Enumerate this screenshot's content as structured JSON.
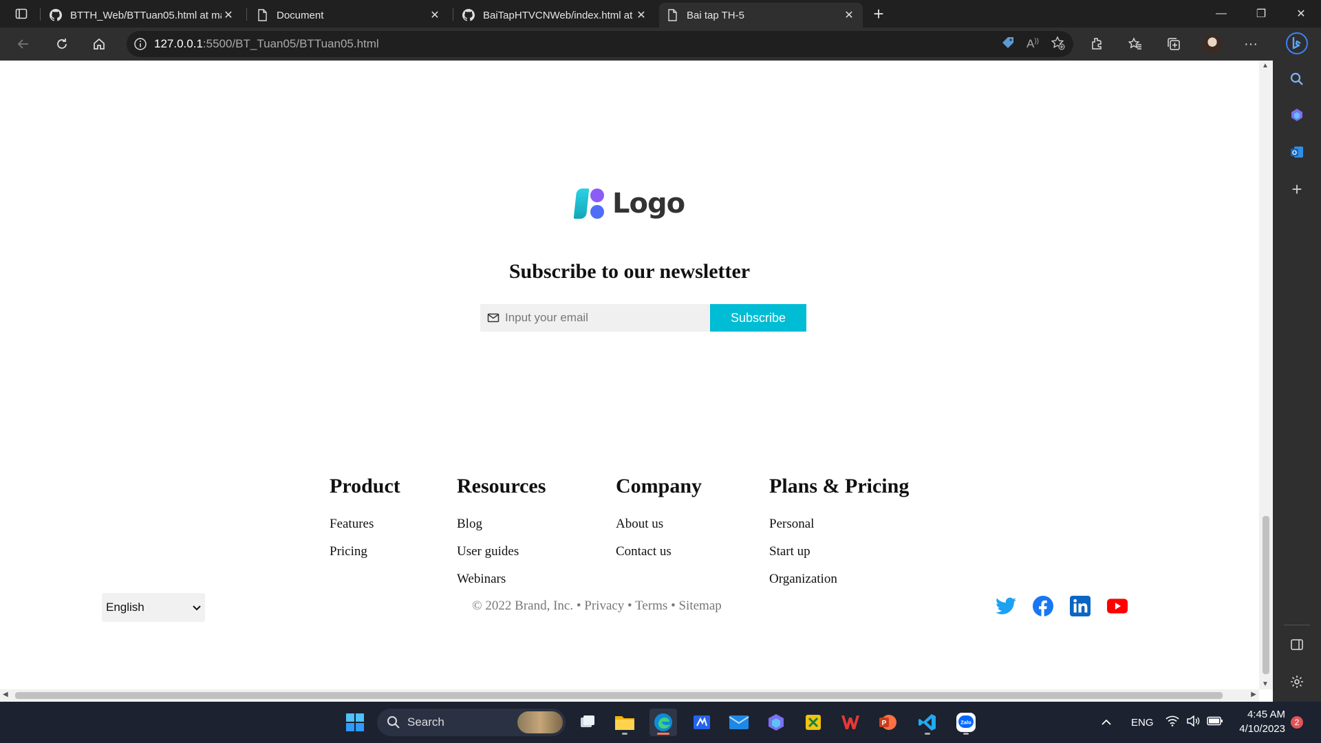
{
  "browser": {
    "tabs": [
      {
        "title": "BTTH_Web/BTTuan05.html at ma",
        "icon": "github-icon",
        "active": false
      },
      {
        "title": "Document",
        "icon": "page-icon",
        "active": false
      },
      {
        "title": "BaiTapHTVCNWeb/index.html at",
        "icon": "github-icon",
        "active": false
      },
      {
        "title": "Bai tap TH-5",
        "icon": "page-icon",
        "active": true
      }
    ],
    "url_host": "127.0.0.1",
    "url_path": ":5500/BT_Tuan05/BTTuan05.html"
  },
  "page": {
    "logo_text": "Logo",
    "newsletter_title": "Subscribe to our newsletter",
    "email_placeholder": "Input your email",
    "subscribe_label": "Subscribe",
    "columns": [
      {
        "heading": "Product",
        "links": [
          "Features",
          "Pricing"
        ]
      },
      {
        "heading": "Resources",
        "links": [
          "Blog",
          "User guides",
          "Webinars"
        ]
      },
      {
        "heading": "Company",
        "links": [
          "About us",
          "Contact us"
        ]
      },
      {
        "heading": "Plans & Pricing",
        "links": [
          "Personal",
          "Start up",
          "Organization"
        ]
      }
    ],
    "language": "English",
    "copyright": "© 2022 Brand, Inc. • Privacy • Terms • Sitemap",
    "socials": [
      "twitter-icon",
      "facebook-icon",
      "linkedin-icon",
      "youtube-icon"
    ],
    "accent_color": "#00bcd4"
  },
  "taskbar": {
    "search_label": "Search",
    "language": "ENG",
    "time": "4:45 AM",
    "date": "4/10/2023",
    "notifications": "2"
  }
}
